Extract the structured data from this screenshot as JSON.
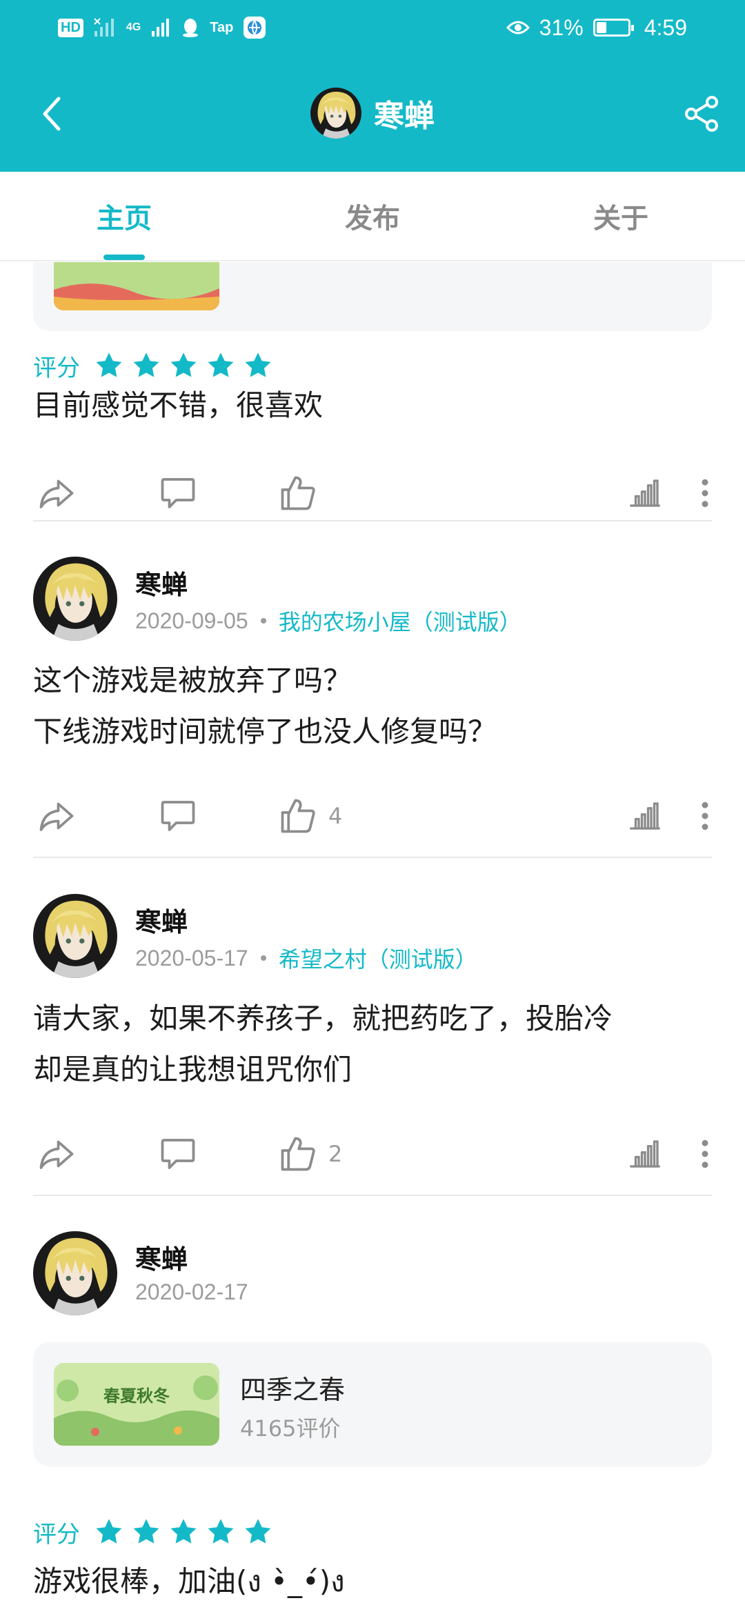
{
  "status_bar": {
    "hd_label": "HD",
    "network_label": "4G",
    "tap_label": "Tap",
    "battery_percent": "31%",
    "time": "4:59"
  },
  "header": {
    "title": "寒蝉"
  },
  "tabs": [
    {
      "label": "主页",
      "active": true
    },
    {
      "label": "发布",
      "active": false
    },
    {
      "label": "关于",
      "active": false
    }
  ],
  "posts": [
    {
      "rating_label": "评分",
      "rating": 5,
      "text": "目前感觉不错，很喜欢"
    },
    {
      "author": "寒蝉",
      "date": "2020-09-05",
      "game": "我的农场小屋（测试版）",
      "text_lines": [
        "这个游戏是被放弃了吗？",
        "下线游戏时间就停了也没人修复吗？"
      ],
      "likes": "4"
    },
    {
      "author": "寒蝉",
      "date": "2020-05-17",
      "game": "希望之村（测试版）",
      "text_lines": [
        "请大家，如果不养孩子，就把药吃了，投胎冷",
        "却是真的让我想诅咒你们"
      ],
      "likes": "2"
    },
    {
      "author": "寒蝉",
      "date": "2020-02-17",
      "game_card": {
        "name": "四季之春",
        "reviews": "4165评价",
        "banner_text": "春夏秋冬"
      },
      "rating_label": "评分",
      "rating": 5,
      "text": "游戏很棒，加油(ง •̀_•́)ง"
    }
  ],
  "colors": {
    "accent": "#14b9c8",
    "text": "#1c1c1c",
    "muted": "#9b9b9b"
  }
}
